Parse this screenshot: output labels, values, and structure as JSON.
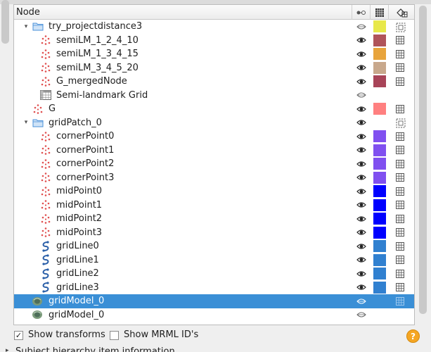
{
  "header": {
    "node_label": "Node"
  },
  "rows": [
    {
      "label": "try_projectdistance3",
      "indent": 1,
      "icon": "folder",
      "expander": "open",
      "vis": "eye-hidden",
      "color": "#e8e84a",
      "edit": "dotted"
    },
    {
      "label": "semiLM_1_2_4_10",
      "indent": 2,
      "icon": "markups",
      "vis": "eye",
      "color": "#b0545a",
      "edit": "grid"
    },
    {
      "label": "semiLM_1_3_4_15",
      "indent": 2,
      "icon": "markups",
      "vis": "eye",
      "color": "#e8a43c",
      "edit": "grid"
    },
    {
      "label": "semiLM_3_4_5_20",
      "indent": 2,
      "icon": "markups",
      "vis": "eye",
      "color": "#c8a88c",
      "edit": "grid"
    },
    {
      "label": "G_mergedNode",
      "indent": 2,
      "icon": "markups",
      "vis": "eye",
      "color": "#a84458",
      "edit": "grid"
    },
    {
      "label": "Semi-landmark Grid",
      "indent": 2,
      "icon": "table",
      "vis": "eye-hidden",
      "color": "",
      "edit": ""
    },
    {
      "label": "G",
      "indent": 1,
      "icon": "markups",
      "vis": "eye",
      "color": "#ff8080",
      "edit": "grid"
    },
    {
      "label": "gridPatch_0",
      "indent": 1,
      "icon": "folder",
      "expander": "open",
      "vis": "eye",
      "color": "",
      "edit": "dotted"
    },
    {
      "label": "cornerPoint0",
      "indent": 2,
      "icon": "markups",
      "vis": "eye",
      "color": "#8050f0",
      "edit": "grid"
    },
    {
      "label": "cornerPoint1",
      "indent": 2,
      "icon": "markups",
      "vis": "eye",
      "color": "#8050f0",
      "edit": "grid"
    },
    {
      "label": "cornerPoint2",
      "indent": 2,
      "icon": "markups",
      "vis": "eye",
      "color": "#8050f0",
      "edit": "grid"
    },
    {
      "label": "cornerPoint3",
      "indent": 2,
      "icon": "markups",
      "vis": "eye",
      "color": "#8050f0",
      "edit": "grid"
    },
    {
      "label": "midPoint0",
      "indent": 2,
      "icon": "markups",
      "vis": "eye",
      "color": "#0000ff",
      "edit": "grid"
    },
    {
      "label": "midPoint1",
      "indent": 2,
      "icon": "markups",
      "vis": "eye",
      "color": "#0000ff",
      "edit": "grid"
    },
    {
      "label": "midPoint2",
      "indent": 2,
      "icon": "markups",
      "vis": "eye",
      "color": "#0000ff",
      "edit": "grid"
    },
    {
      "label": "midPoint3",
      "indent": 2,
      "icon": "markups",
      "vis": "eye",
      "color": "#0000ff",
      "edit": "grid"
    },
    {
      "label": "gridLine0",
      "indent": 2,
      "icon": "curve",
      "vis": "eye",
      "color": "#3080d0",
      "edit": "grid"
    },
    {
      "label": "gridLine1",
      "indent": 2,
      "icon": "curve",
      "vis": "eye",
      "color": "#3080d0",
      "edit": "grid"
    },
    {
      "label": "gridLine2",
      "indent": 2,
      "icon": "curve",
      "vis": "eye",
      "color": "#3080d0",
      "edit": "grid"
    },
    {
      "label": "gridLine3",
      "indent": 2,
      "icon": "curve",
      "vis": "eye",
      "color": "#3080d0",
      "edit": "grid"
    },
    {
      "label": "gridModel_0",
      "indent": 1,
      "icon": "model",
      "vis": "eye-hidden",
      "color": "",
      "edit": "grid",
      "selected": true
    },
    {
      "label": "gridModel_0",
      "indent": 1,
      "icon": "model",
      "vis": "eye-hidden",
      "color": "",
      "edit": ""
    }
  ],
  "options": {
    "show_transforms_label": "Show transforms",
    "show_transforms_checked": true,
    "show_mrml_ids_label": "Show MRML ID's",
    "show_mrml_ids_checked": false
  },
  "help_label": "?",
  "subject_section_label": "Subject hierarchy item information",
  "colors": {
    "selection": "#3a8fd6",
    "folder": "#4a90d9",
    "markups": "#e05050"
  }
}
